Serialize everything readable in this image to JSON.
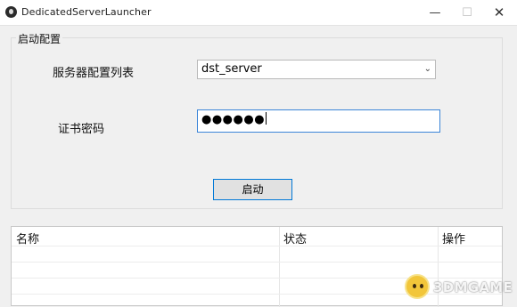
{
  "window": {
    "title": "DedicatedServerLauncher",
    "minimize": "—",
    "maximize": "☐",
    "close": "✕",
    "icon": "app-icon"
  },
  "group": {
    "legend": "启动配置"
  },
  "form": {
    "config_list_label": "服务器配置列表",
    "config_list_value": "dst_server",
    "password_label": "证书密码",
    "password_value": "●●●●●●",
    "start_button": "启动"
  },
  "table": {
    "headers": [
      "名称",
      "状态",
      "操作"
    ]
  },
  "watermark": {
    "text": "3DMGAME"
  }
}
